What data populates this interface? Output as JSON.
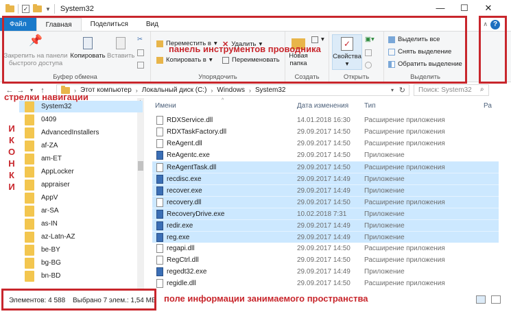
{
  "window": {
    "title": "System32",
    "controls": [
      "—",
      "☐",
      "✕"
    ]
  },
  "ribbon_tabs": [
    "Файл",
    "Главная",
    "Поделиться",
    "Вид"
  ],
  "clipboard": {
    "pin_label": "Закрепить на панели быстрого доступа",
    "copy_label": "Копировать",
    "paste_label": "Вставить",
    "group_label": "Буфер обмена"
  },
  "organize": {
    "move_label": "Переместить в",
    "copy_to_label": "Копировать в",
    "delete_label": "Удалить",
    "rename_label": "Переименовать",
    "group_label": "Упорядочить"
  },
  "create": {
    "new_folder_label": "Новая папка",
    "group_label": "Создать"
  },
  "open": {
    "properties_label": "Свойства",
    "group_label": "Открыть"
  },
  "select": {
    "select_all": "Выделить все",
    "deselect": "Снять выделение",
    "invert": "Обратить выделение",
    "group_label": "Выделить"
  },
  "address": {
    "crumbs": [
      "Этот компьютер",
      "Локальный диск (C:)",
      "Windows",
      "System32"
    ],
    "search_placeholder": "Поиск: System32"
  },
  "nav_pane": {
    "items": [
      {
        "name": "System32",
        "selected": true
      },
      {
        "name": "0409",
        "selected": false
      },
      {
        "name": "AdvancedInstallers",
        "selected": false
      },
      {
        "name": "af-ZA",
        "selected": false
      },
      {
        "name": "am-ET",
        "selected": false
      },
      {
        "name": "AppLocker",
        "selected": false
      },
      {
        "name": "appraiser",
        "selected": false
      },
      {
        "name": "AppV",
        "selected": false
      },
      {
        "name": "ar-SA",
        "selected": false
      },
      {
        "name": "as-IN",
        "selected": false
      },
      {
        "name": "az-Latn-AZ",
        "selected": false
      },
      {
        "name": "be-BY",
        "selected": false
      },
      {
        "name": "bg-BG",
        "selected": false
      },
      {
        "name": "bn-BD",
        "selected": false
      }
    ]
  },
  "file_list": {
    "columns": [
      "Имени",
      "Дата изменения",
      "Тип",
      "Ра"
    ],
    "rows": [
      {
        "name": "RDXService.dll",
        "date": "14.01.2018 16:30",
        "type": "Расширение приложения",
        "icon": "dll",
        "selected": false
      },
      {
        "name": "RDXTaskFactory.dll",
        "date": "29.09.2017 14:50",
        "type": "Расширение приложения",
        "icon": "dll",
        "selected": false
      },
      {
        "name": "ReAgent.dll",
        "date": "29.09.2017 14:50",
        "type": "Расширение приложения",
        "icon": "dll",
        "selected": false
      },
      {
        "name": "ReAgentc.exe",
        "date": "29.09.2017 14:50",
        "type": "Приложение",
        "icon": "exe",
        "selected": false
      },
      {
        "name": "ReAgentTask.dll",
        "date": "29.09.2017 14:50",
        "type": "Расширение приложения",
        "icon": "dll",
        "selected": true
      },
      {
        "name": "recdisc.exe",
        "date": "29.09.2017 14:49",
        "type": "Приложение",
        "icon": "exe",
        "selected": true
      },
      {
        "name": "recover.exe",
        "date": "29.09.2017 14:49",
        "type": "Приложение",
        "icon": "exe",
        "selected": true
      },
      {
        "name": "recovery.dll",
        "date": "29.09.2017 14:50",
        "type": "Расширение приложения",
        "icon": "dll",
        "selected": true
      },
      {
        "name": "RecoveryDrive.exe",
        "date": "10.02.2018 7:31",
        "type": "Приложение",
        "icon": "exe",
        "selected": true
      },
      {
        "name": "redir.exe",
        "date": "29.09.2017 14:49",
        "type": "Приложение",
        "icon": "exe",
        "selected": true
      },
      {
        "name": "reg.exe",
        "date": "29.09.2017 14:49",
        "type": "Приложение",
        "icon": "exe",
        "selected": true
      },
      {
        "name": "regapi.dll",
        "date": "29.09.2017 14:50",
        "type": "Расширение приложения",
        "icon": "dll",
        "selected": false
      },
      {
        "name": "RegCtrl.dll",
        "date": "29.09.2017 14:50",
        "type": "Расширение приложения",
        "icon": "dll",
        "selected": false
      },
      {
        "name": "regedt32.exe",
        "date": "29.09.2017 14:49",
        "type": "Приложение",
        "icon": "exe",
        "selected": false
      },
      {
        "name": "regidle.dll",
        "date": "29.09.2017 14:50",
        "type": "Расширение приложения",
        "icon": "dll",
        "selected": false
      }
    ]
  },
  "status": {
    "count": "Элементов: 4 588",
    "selected": "Выбрано 7 элем.: 1,54 МБ"
  },
  "annotations": {
    "toolbar": "панель инструментов проводника",
    "nav_arrows": "стрелки навигации",
    "icons_vertical": [
      "И",
      "К",
      "О",
      "Н",
      "К",
      "И"
    ],
    "space_info": "поле информации занимаемого пространства"
  },
  "colors": {
    "accent": "#1979ca",
    "selection": "#cce8ff",
    "annotation": "#c8262c",
    "folder": "#f3c64f"
  }
}
